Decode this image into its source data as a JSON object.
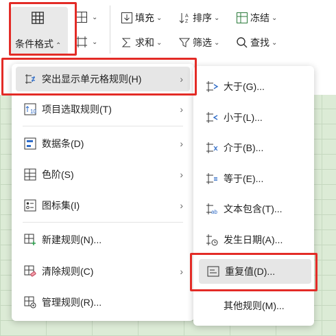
{
  "ribbon": {
    "conditional_format_label": "条件格式",
    "fill_label": "填充",
    "sort_label": "排序",
    "freeze_label": "冻结",
    "sum_label": "求和",
    "filter_label": "筛选",
    "find_label": "查找"
  },
  "menu_main": {
    "items": [
      {
        "label": "突出显示单元格规则(H)",
        "icon": "highlight-cells-icon"
      },
      {
        "label": "项目选取规则(T)",
        "icon": "top-bottom-icon"
      },
      {
        "label": "数据条(D)",
        "icon": "data-bars-icon"
      },
      {
        "label": "色阶(S)",
        "icon": "color-scales-icon"
      },
      {
        "label": "图标集(I)",
        "icon": "icon-sets-icon"
      },
      {
        "label": "新建规则(N)...",
        "icon": "new-rule-icon"
      },
      {
        "label": "清除规则(C)",
        "icon": "clear-rules-icon"
      },
      {
        "label": "管理规则(R)...",
        "icon": "manage-rules-icon"
      }
    ]
  },
  "menu_sub": {
    "items": [
      {
        "label": "大于(G)...",
        "icon": "greater-than-icon"
      },
      {
        "label": "小于(L)...",
        "icon": "less-than-icon"
      },
      {
        "label": "介于(B)...",
        "icon": "between-icon"
      },
      {
        "label": "等于(E)...",
        "icon": "equal-to-icon"
      },
      {
        "label": "文本包含(T)...",
        "icon": "text-contains-icon"
      },
      {
        "label": "发生日期(A)...",
        "icon": "date-occurring-icon"
      },
      {
        "label": "重复值(D)...",
        "icon": "duplicate-values-icon"
      },
      {
        "label": "其他规则(M)..."
      }
    ]
  },
  "colors": {
    "highlight": "#e32b26",
    "icon_blue": "#2f6cc7"
  }
}
